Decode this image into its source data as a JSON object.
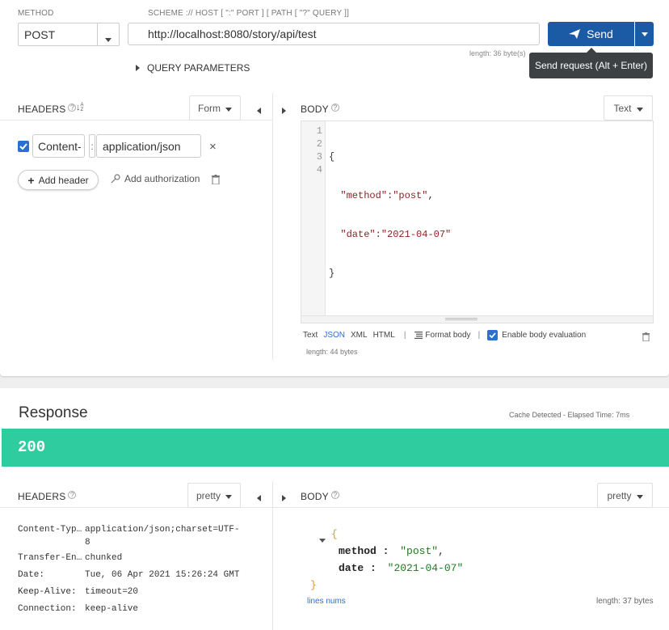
{
  "request": {
    "method_label": "METHOD",
    "method_value": "POST",
    "url_label": "SCHEME :// HOST [ \":\" PORT ] [ PATH [ \"?\" QUERY ]]",
    "url_value": "http://localhost:8080/story/api/test",
    "length_text": "length: 36 byte(s)",
    "send_label": "Send",
    "send_tooltip": "Send request (Alt + Enter)",
    "query_params_label": "QUERY PARAMETERS",
    "headers": {
      "title": "HEADERS",
      "help": "?",
      "sort_glyph": "↓",
      "sort_glyph_sub": "A Z",
      "mode": "Form",
      "rows": [
        {
          "enabled": true,
          "name": "Content-",
          "separator": ":",
          "value": "application/json",
          "remove": "×"
        }
      ],
      "add_header": "Add header",
      "add_auth": "Add authorization"
    },
    "body": {
      "title": "BODY",
      "help": "?",
      "mode": "Text",
      "line_numbers": [
        "1",
        "2",
        "3",
        "4"
      ],
      "lines": [
        {
          "open": "{"
        },
        {
          "key": "\"method\"",
          "colon": ":",
          "value": "\"post\"",
          "comma": ","
        },
        {
          "key": "\"date\"",
          "colon": ":",
          "value": "\"2021-04-07\"",
          "comma": ""
        },
        {
          "close": "}"
        }
      ],
      "formats": [
        "Text",
        "JSON",
        "XML",
        "HTML"
      ],
      "active_format": "JSON",
      "divider": "|",
      "format_body": "Format body",
      "enable_eval": "Enable body evaluation",
      "length_text": "length: 44 bytes"
    }
  },
  "response": {
    "title": "Response",
    "meta": "Cache Detected - Elapsed Time: 7ms",
    "status_code": "200",
    "status_color": "#2ecc9e",
    "headers": {
      "title": "HEADERS",
      "help": "?",
      "mode": "pretty",
      "rows": [
        {
          "name": "Content-Typ…",
          "value": "application/json;charset=UTF-",
          "value2": "8"
        },
        {
          "name": "Transfer-En…",
          "value": "chunked"
        },
        {
          "name": "Date:",
          "value": "Tue, 06 Apr 2021 15:26:24 GMT"
        },
        {
          "name": "Keep-Alive:",
          "value": "timeout=20"
        },
        {
          "name": "Connection:",
          "value": "keep-alive"
        }
      ]
    },
    "body": {
      "title": "BODY",
      "help": "?",
      "mode": "pretty",
      "open_brace": "{",
      "close_brace": "}",
      "entries": [
        {
          "key": "method",
          "colon": " :",
          "value": "\"post\"",
          "comma": ","
        },
        {
          "key": "date",
          "colon": " :",
          "value": "\"2021-04-07\"",
          "comma": ""
        }
      ],
      "lines_nums": "lines nums",
      "length_text": "length: 37 bytes"
    }
  },
  "colors": {
    "send_blue": "#1b5ba6",
    "accent_blue": "#2b6fd1",
    "json_key": "#8a1f1f",
    "json_string_green": "#1f7a1f",
    "brace_orange": "#d89b2b"
  }
}
